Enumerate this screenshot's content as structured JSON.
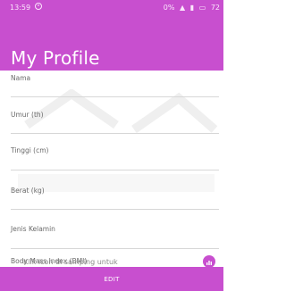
{
  "statusbar": {
    "time": "13:59",
    "network": "0%",
    "battery": "72"
  },
  "page": {
    "title": "My Profile"
  },
  "fields": [
    {
      "label": "Nama"
    },
    {
      "label": "Umur (th)"
    },
    {
      "label": "Tinggi (cm)"
    },
    {
      "label": "Berat (kg)"
    },
    {
      "label": "Jenis Kelamin"
    },
    {
      "label": "Body Mass Index (BMI)"
    }
  ],
  "bmi": {
    "hint": "Klik icon di samping untuk"
  },
  "footer": {
    "edit_label": "EDIT"
  },
  "colors": {
    "accent": "#c84fcf",
    "text_muted": "#6a6a6a",
    "divider": "#d7d7d7"
  }
}
